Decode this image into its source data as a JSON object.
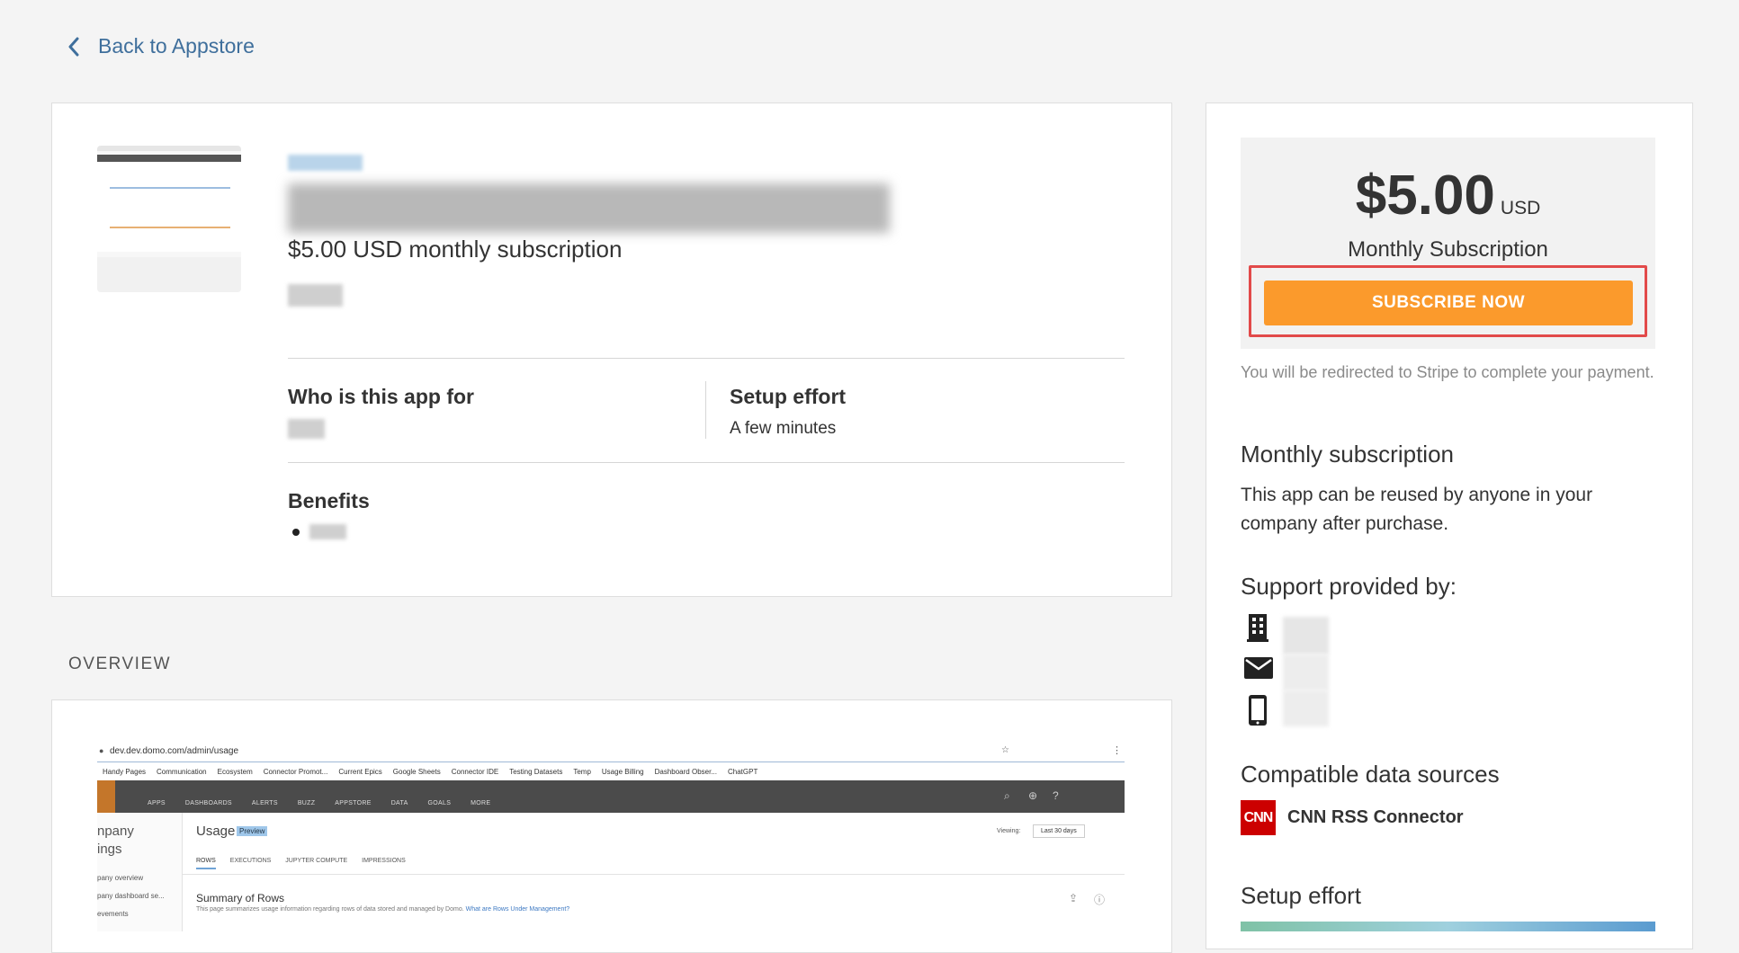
{
  "back_link": {
    "label": "Back to Appstore"
  },
  "app": {
    "subtitle": "$5.00 USD monthly subscription",
    "who_heading": "Who is this app for",
    "setup_heading": "Setup effort",
    "setup_value": "A few minutes",
    "benefits_heading": "Benefits"
  },
  "overview": {
    "label": "OVERVIEW",
    "screenshot": {
      "url": "dev.dev.domo.com/admin/usage",
      "bookmarks": [
        "Handy Pages",
        "Communication",
        "Ecosystem",
        "Connector Promot...",
        "Current Epics",
        "Google Sheets",
        "Connector IDE",
        "Testing Datasets",
        "Temp",
        "Usage Billing",
        "Dashboard Obser...",
        "ChatGPT"
      ],
      "nav": [
        "APPS",
        "DASHBOARDS",
        "ALERTS",
        "BUZZ",
        "APPSTORE",
        "DATA",
        "GOALS",
        "MORE"
      ],
      "sidebar_top1": "npany",
      "sidebar_top2": "ings",
      "sidebar_items": [
        "pany overview",
        "pany dashboard se...",
        "evements"
      ],
      "page_title": "Usage",
      "badge": "Preview",
      "viewing_label": "Viewing:",
      "viewing_value": "Last 30 days",
      "tabs": [
        "ROWS",
        "EXECUTIONS",
        "JUPYTER COMPUTE",
        "IMPRESSIONS"
      ],
      "summary_title": "Summary of Rows",
      "summary_desc": "This page summarizes usage information regarding rows of data stored and managed by Domo.",
      "summary_link": "What are Rows Under Management?"
    }
  },
  "pricing": {
    "amount": "$5.00",
    "currency": "USD",
    "label": "Monthly Subscription",
    "subscribe_label": "SUBSCRIBE NOW",
    "redirect_note": "You will be redirected to Stripe to complete your payment."
  },
  "sidebar": {
    "monthly_heading": "Monthly subscription",
    "monthly_text": "This app can be reused by anyone in your company after purchase.",
    "support_heading": "Support provided by:",
    "support_icons": [
      "building-icon",
      "mail-icon",
      "phone-icon"
    ],
    "compatible_heading": "Compatible data sources",
    "source_logo": "CNN",
    "source_name": "CNN RSS Connector",
    "setup_heading": "Setup effort"
  },
  "colors": {
    "accent_orange": "#fb9a2c",
    "link_blue": "#3f6f9c",
    "highlight_red": "#e24a4a",
    "cnn_red": "#cc0000"
  }
}
